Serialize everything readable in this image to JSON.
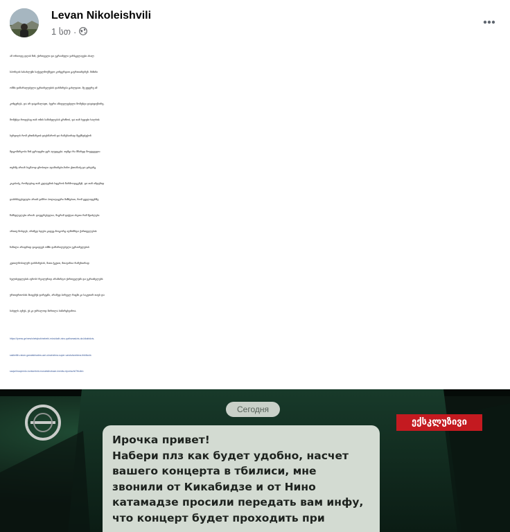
{
  "post": {
    "author": "Levan Nikoleishvili",
    "time": "1 სთ",
    "separator": "·",
    "privacy_icon": "globe-icon",
    "more_icon": "more-horizontal-icon",
    "body_lines": [
      "ამ ორიოდე დღის წინ, ქართველი და უკრაინელი ვარსკვლავები ახალ",
      "სპორტის სასახლეში საქველმოქმედო კონცერტით გაერთიანდნენ. მიზანი",
      "ომში დაზარალებული უკრაინელების დახმარება გახლდათ. მე ვუყურე ამ",
      "კონცერტს, და არ დაგიმალავთ, ბევრი ამაღელვებელი მომენტი დავაფიქსირე,",
      "მომენტი როდესაც თან ომის საშინელებას გრძნობ, და თან ხვდები ხალხის",
      "სურვილს რომ ერთმანეთს დაეხმარონ და რამენაირად შეუმსუბუქონ",
      "მდგომარეობა წინ ვერაფერი ვერ აღუდგება. თუმცა რა მწარედ მოვტყუვდი:",
      "თურმე არიან საკმაოდ ცნობილი ადამიანები-ნინო ქათამაძე და ვახტანგ",
      "კიკაბიძე, რომლებიც თან კულტურის სფეროს წარმოადგენენ, და თან იმდენად",
      "დაბრმავებულები არიან ვიწრო პოლიტიკური მიზნებით, რომ ყველაფერზე",
      "წამსვლელები არიან. დაუჯერებელია, მაგრამ ფაქტია ასეთი რამ შეიძლება",
      "არათუ მოხდეს, არამედ ხდება კიდეც-როგორც აღმოჩნდა ქართველების",
      "ნაწილი არაფრად დაგიდევს ომში დაზარალებული უკრაინელების",
      "კეთილმობილურ დახმარებას, მათი ჭკუით, მთავარია რამენაირად",
      "ხელისუფლებას ავნოს! რეალურად არამარტო ქართველებს და უკრაინელებს",
      "ურთიერთობას მიაყენეს დარტყმა, არამედ პირველ რიგში კი საკუთარ თავს და",
      "სახელს ავნეს, ეს კი უბრალოდ მართლა სამარცხვინოა."
    ],
    "link_lines": [
      "https://ipress.ge/new/shetqhobinebebi-miuvidath-nino-qathamadzis-da-kikabidzis-",
      "sakhelith-ratom-ganatskhades-uari-ukrainelma-super-varskvlavebma-thbilisshi-",
      "saqvelmoqmedo-kontsertshi-monatsileobaze-imedis-reportazhi/?fbclid="
    ]
  },
  "media": {
    "date_chip": "Сегодня",
    "badge": "ექსკლუზივი",
    "channel_logo_icon": "imedi-logo-icon",
    "message_lines": [
      "Ирочка привет!",
      "Набери плз как будет удобно, насчет",
      "вашего концерта в тбилиси, мне",
      "звонили от Кикабидзе и от Нино",
      "катамадзе просили передать вам инфу,",
      "что концерт будет проходить при"
    ],
    "colors": {
      "badge_bg": "#c41a20",
      "screen_bg": "#0e2a1c",
      "bubble_bg": "#d6ddd4"
    }
  }
}
